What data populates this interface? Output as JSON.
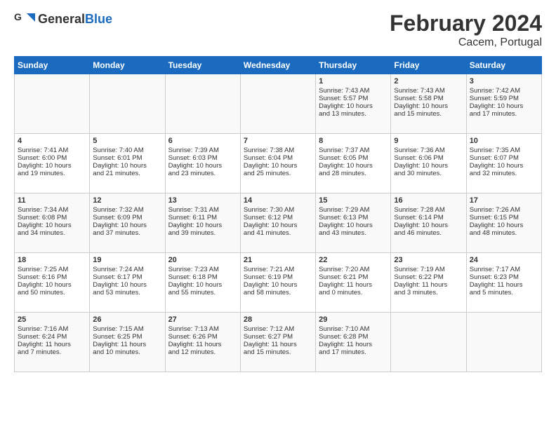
{
  "header": {
    "logo_general": "General",
    "logo_blue": "Blue",
    "title": "February 2024",
    "subtitle": "Cacem, Portugal"
  },
  "weekdays": [
    "Sunday",
    "Monday",
    "Tuesday",
    "Wednesday",
    "Thursday",
    "Friday",
    "Saturday"
  ],
  "weeks": [
    {
      "days": [
        {
          "number": "",
          "info": ""
        },
        {
          "number": "",
          "info": ""
        },
        {
          "number": "",
          "info": ""
        },
        {
          "number": "",
          "info": ""
        },
        {
          "number": "1",
          "info": "Sunrise: 7:43 AM\nSunset: 5:57 PM\nDaylight: 10 hours\nand 13 minutes."
        },
        {
          "number": "2",
          "info": "Sunrise: 7:43 AM\nSunset: 5:58 PM\nDaylight: 10 hours\nand 15 minutes."
        },
        {
          "number": "3",
          "info": "Sunrise: 7:42 AM\nSunset: 5:59 PM\nDaylight: 10 hours\nand 17 minutes."
        }
      ]
    },
    {
      "days": [
        {
          "number": "4",
          "info": "Sunrise: 7:41 AM\nSunset: 6:00 PM\nDaylight: 10 hours\nand 19 minutes."
        },
        {
          "number": "5",
          "info": "Sunrise: 7:40 AM\nSunset: 6:01 PM\nDaylight: 10 hours\nand 21 minutes."
        },
        {
          "number": "6",
          "info": "Sunrise: 7:39 AM\nSunset: 6:03 PM\nDaylight: 10 hours\nand 23 minutes."
        },
        {
          "number": "7",
          "info": "Sunrise: 7:38 AM\nSunset: 6:04 PM\nDaylight: 10 hours\nand 25 minutes."
        },
        {
          "number": "8",
          "info": "Sunrise: 7:37 AM\nSunset: 6:05 PM\nDaylight: 10 hours\nand 28 minutes."
        },
        {
          "number": "9",
          "info": "Sunrise: 7:36 AM\nSunset: 6:06 PM\nDaylight: 10 hours\nand 30 minutes."
        },
        {
          "number": "10",
          "info": "Sunrise: 7:35 AM\nSunset: 6:07 PM\nDaylight: 10 hours\nand 32 minutes."
        }
      ]
    },
    {
      "days": [
        {
          "number": "11",
          "info": "Sunrise: 7:34 AM\nSunset: 6:08 PM\nDaylight: 10 hours\nand 34 minutes."
        },
        {
          "number": "12",
          "info": "Sunrise: 7:32 AM\nSunset: 6:09 PM\nDaylight: 10 hours\nand 37 minutes."
        },
        {
          "number": "13",
          "info": "Sunrise: 7:31 AM\nSunset: 6:11 PM\nDaylight: 10 hours\nand 39 minutes."
        },
        {
          "number": "14",
          "info": "Sunrise: 7:30 AM\nSunset: 6:12 PM\nDaylight: 10 hours\nand 41 minutes."
        },
        {
          "number": "15",
          "info": "Sunrise: 7:29 AM\nSunset: 6:13 PM\nDaylight: 10 hours\nand 43 minutes."
        },
        {
          "number": "16",
          "info": "Sunrise: 7:28 AM\nSunset: 6:14 PM\nDaylight: 10 hours\nand 46 minutes."
        },
        {
          "number": "17",
          "info": "Sunrise: 7:26 AM\nSunset: 6:15 PM\nDaylight: 10 hours\nand 48 minutes."
        }
      ]
    },
    {
      "days": [
        {
          "number": "18",
          "info": "Sunrise: 7:25 AM\nSunset: 6:16 PM\nDaylight: 10 hours\nand 50 minutes."
        },
        {
          "number": "19",
          "info": "Sunrise: 7:24 AM\nSunset: 6:17 PM\nDaylight: 10 hours\nand 53 minutes."
        },
        {
          "number": "20",
          "info": "Sunrise: 7:23 AM\nSunset: 6:18 PM\nDaylight: 10 hours\nand 55 minutes."
        },
        {
          "number": "21",
          "info": "Sunrise: 7:21 AM\nSunset: 6:19 PM\nDaylight: 10 hours\nand 58 minutes."
        },
        {
          "number": "22",
          "info": "Sunrise: 7:20 AM\nSunset: 6:21 PM\nDaylight: 11 hours\nand 0 minutes."
        },
        {
          "number": "23",
          "info": "Sunrise: 7:19 AM\nSunset: 6:22 PM\nDaylight: 11 hours\nand 3 minutes."
        },
        {
          "number": "24",
          "info": "Sunrise: 7:17 AM\nSunset: 6:23 PM\nDaylight: 11 hours\nand 5 minutes."
        }
      ]
    },
    {
      "days": [
        {
          "number": "25",
          "info": "Sunrise: 7:16 AM\nSunset: 6:24 PM\nDaylight: 11 hours\nand 7 minutes."
        },
        {
          "number": "26",
          "info": "Sunrise: 7:15 AM\nSunset: 6:25 PM\nDaylight: 11 hours\nand 10 minutes."
        },
        {
          "number": "27",
          "info": "Sunrise: 7:13 AM\nSunset: 6:26 PM\nDaylight: 11 hours\nand 12 minutes."
        },
        {
          "number": "28",
          "info": "Sunrise: 7:12 AM\nSunset: 6:27 PM\nDaylight: 11 hours\nand 15 minutes."
        },
        {
          "number": "29",
          "info": "Sunrise: 7:10 AM\nSunset: 6:28 PM\nDaylight: 11 hours\nand 17 minutes."
        },
        {
          "number": "",
          "info": ""
        },
        {
          "number": "",
          "info": ""
        }
      ]
    }
  ]
}
